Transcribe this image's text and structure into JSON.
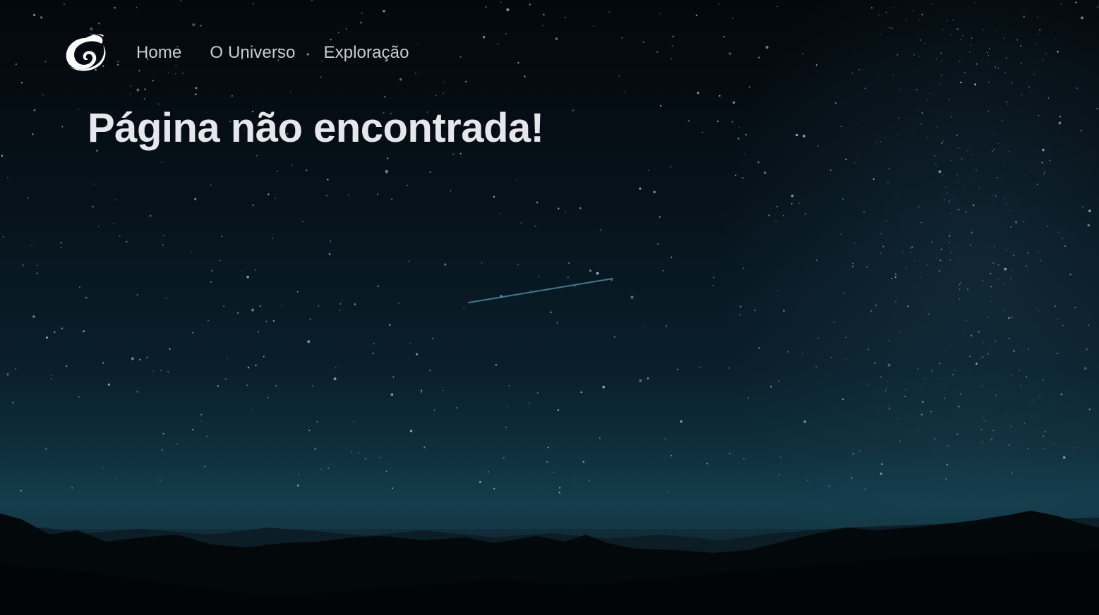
{
  "brand": {
    "logo_icon": "galaxy-swirl-icon"
  },
  "nav": {
    "items": [
      {
        "label": "Home"
      },
      {
        "label": "O Universo"
      },
      {
        "label": "Exploração"
      }
    ]
  },
  "main": {
    "title": "Página não encontrada!"
  },
  "background": {
    "description_icon": "night-sky-mountains",
    "colors": {
      "sky_top": "#03080c",
      "sky_horizon": "#123846",
      "mountains": "#03070a"
    }
  }
}
